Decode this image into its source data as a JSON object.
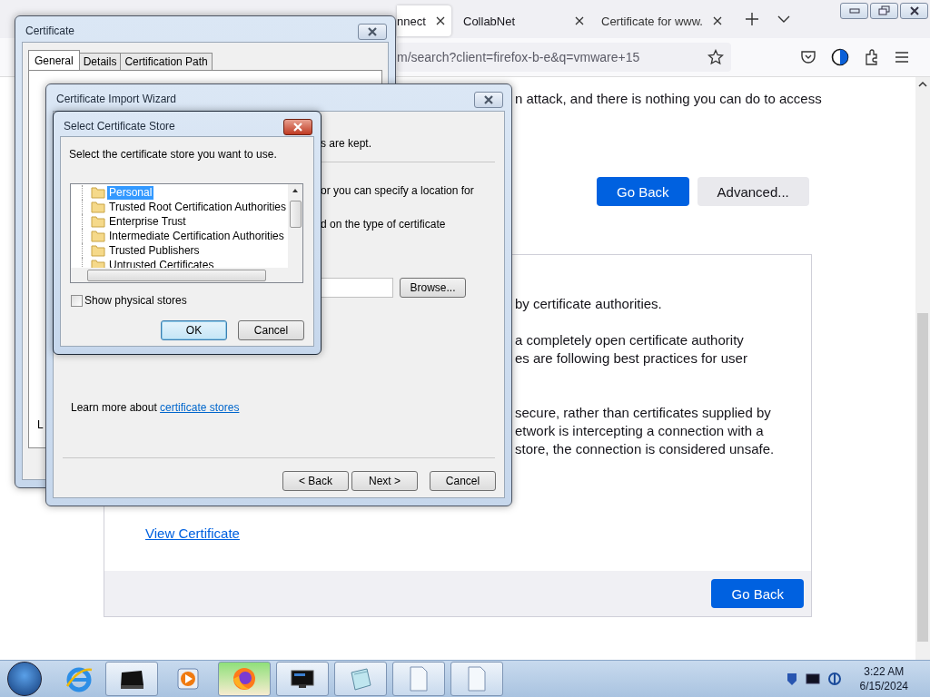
{
  "browser": {
    "tabs": [
      {
        "title": "nnect",
        "selected": true
      },
      {
        "title": "CollabNet",
        "selected": false
      },
      {
        "title": "Certificate for www.",
        "selected": false
      }
    ],
    "address": "m/search?client=firefox-b-e&q=vmware+15"
  },
  "page": {
    "intro": "n attack, and there is nothing you can do to access",
    "buttons": [
      {
        "label": "Go Back",
        "kind": "primary"
      },
      {
        "label": "Advanced...",
        "kind": "secondary"
      }
    ],
    "details": {
      "paragraphs": [
        [
          "by certificate authorities."
        ],
        [
          "a completely open certificate authority",
          "es are following best practices for user"
        ],
        [
          "secure, rather than certificates supplied by",
          "etwork is intercepting a connection with a",
          "store, the connection is considered unsafe."
        ]
      ],
      "link": "View Certificate",
      "button": "Go Back"
    }
  },
  "certificate_window": {
    "title": "Certificate",
    "tabs": [
      {
        "label": "General",
        "selected": true
      },
      {
        "label": "Details",
        "selected": false
      },
      {
        "label": "Certification Path",
        "selected": false
      }
    ],
    "fragment": "L"
  },
  "import_wizard": {
    "title": "Certificate Import Wizard",
    "lines": [
      "s are kept.",
      "or you can specify a location for",
      "d on the type of certificate"
    ],
    "browse": "Browse...",
    "learn_more": "Learn more about",
    "link": "certificate stores",
    "buttons": [
      "< Back",
      "Next >",
      "Cancel"
    ]
  },
  "store_dialog": {
    "title": "Select Certificate Store",
    "prompt": "Select the certificate store you want to use.",
    "stores": [
      {
        "name": "Personal",
        "selected": true
      },
      {
        "name": "Trusted Root Certification Authorities",
        "selected": false
      },
      {
        "name": "Enterprise Trust",
        "selected": false
      },
      {
        "name": "Intermediate Certification Authorities",
        "selected": false
      },
      {
        "name": "Trusted Publishers",
        "selected": false
      },
      {
        "name": "Untrusted Certificates",
        "selected": false
      }
    ],
    "show_physical": {
      "label": "Show physical stores",
      "checked": false
    },
    "buttons": [
      "OK",
      "Cancel"
    ]
  },
  "taskbar": {
    "apps": [
      {
        "kind": "ie",
        "open": false,
        "selected": false
      },
      {
        "kind": "printer",
        "open": true,
        "selected": false
      },
      {
        "kind": "media",
        "open": false,
        "selected": false
      },
      {
        "kind": "firefox",
        "open": true,
        "selected": true
      },
      {
        "kind": "display",
        "open": true,
        "selected": false
      },
      {
        "kind": "notepad",
        "open": true,
        "selected": false
      },
      {
        "kind": "document",
        "open": true,
        "selected": false
      },
      {
        "kind": "document",
        "open": true,
        "selected": false
      }
    ],
    "time": "3:22 AM",
    "date": "6/15/2024"
  }
}
